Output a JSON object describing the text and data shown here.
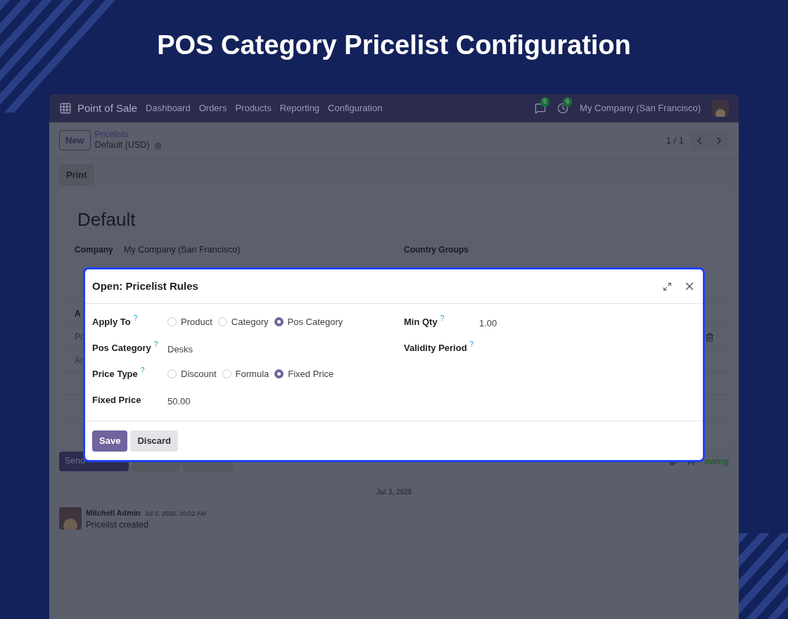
{
  "page_title": "POS Category Pricelist Configuration",
  "navbar": {
    "app_name": "Point of Sale",
    "menu": [
      "Dashboard",
      "Orders",
      "Products",
      "Reporting",
      "Configuration"
    ],
    "messages_badge": "5",
    "activities_badge": "6",
    "company": "My Company (San Francisco)"
  },
  "control_panel": {
    "new_button": "New",
    "breadcrumb": "Pricelists",
    "record": "Default (USD)",
    "pager": "1 / 1"
  },
  "print_button": "Print",
  "form": {
    "name": "Default",
    "fields": [
      {
        "label": "Company",
        "value": "My Company (San Francisco)"
      },
      {
        "label": "Country Groups"
      }
    ],
    "table_rows": [
      "A",
      "Po",
      "Ac"
    ]
  },
  "chatter": {
    "send_button": "Send",
    "follow_text": "owing",
    "date": "Jul 3, 2025",
    "messages": [
      {
        "author": "Mitchell Admin",
        "time": "Jul 3, 2025, 10:02 AM",
        "body": "Pricelist created"
      }
    ]
  },
  "dialog": {
    "title": "Open: Pricelist Rules",
    "left_fields": [
      {
        "kind": "radio",
        "label": "Apply To",
        "help": "?",
        "options": [
          {
            "label": "Product",
            "selected": false
          },
          {
            "label": "Category",
            "selected": false
          },
          {
            "label": "Pos Category",
            "selected": true
          }
        ]
      },
      {
        "kind": "text",
        "label": "Pos Category",
        "help": "?",
        "value": "Desks"
      },
      {
        "kind": "radio",
        "label": "Price Type",
        "help": "?",
        "options": [
          {
            "label": "Discount",
            "selected": false
          },
          {
            "label": "Formula",
            "selected": false
          },
          {
            "label": "Fixed Price",
            "selected": true
          }
        ]
      },
      {
        "kind": "text",
        "label": "Fixed Price",
        "value": "50.00"
      }
    ],
    "right_fields": [
      {
        "kind": "text",
        "label": "Min Qty",
        "help": "?",
        "value": "1.00"
      },
      {
        "kind": "text",
        "label": "Validity Period",
        "help": "?"
      }
    ],
    "buttons": [
      {
        "label": "Save",
        "kind": "primary"
      },
      {
        "label": "Discard",
        "kind": "secondary"
      }
    ]
  }
}
